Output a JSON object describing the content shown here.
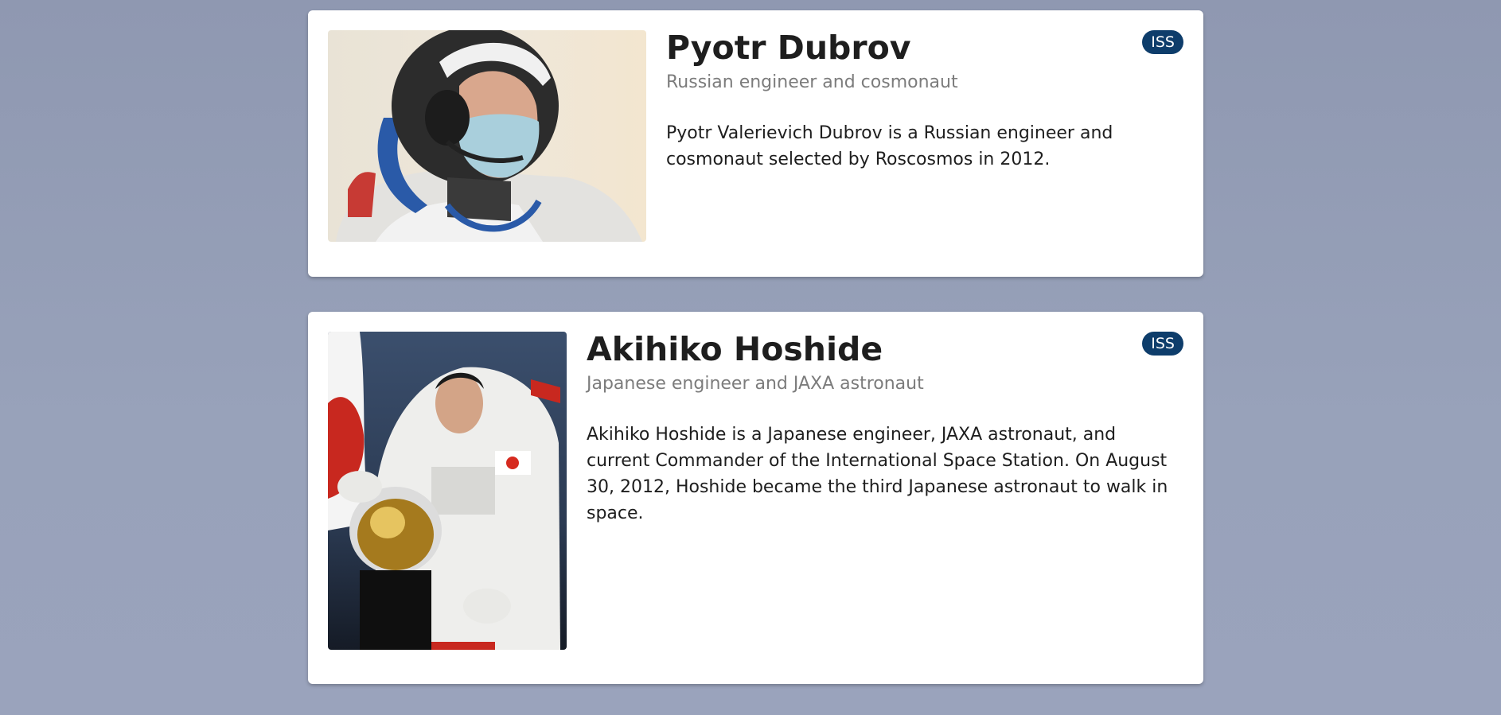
{
  "astronauts": [
    {
      "name": "Pyotr Dubrov",
      "subtitle": "Russian engineer and cosmonaut",
      "bio": "Pyotr Valerievich Dubrov is a Russian engineer and cosmonaut selected by Roscosmos in 2012.",
      "badge": "ISS"
    },
    {
      "name": "Akihiko Hoshide",
      "subtitle": "Japanese engineer and JAXA astronaut",
      "bio": "Akihiko Hoshide is a Japanese engineer, JAXA astronaut, and current Commander of the International Space Station. On August 30, 2012, Hoshide became the third Japanese astronaut to walk in space.",
      "badge": "ISS"
    }
  ],
  "colors": {
    "background": "#949db5",
    "card": "#ffffff",
    "badge": "#0e3d6b",
    "subtitle": "#7c7c7c",
    "text": "#1e1e1e"
  }
}
